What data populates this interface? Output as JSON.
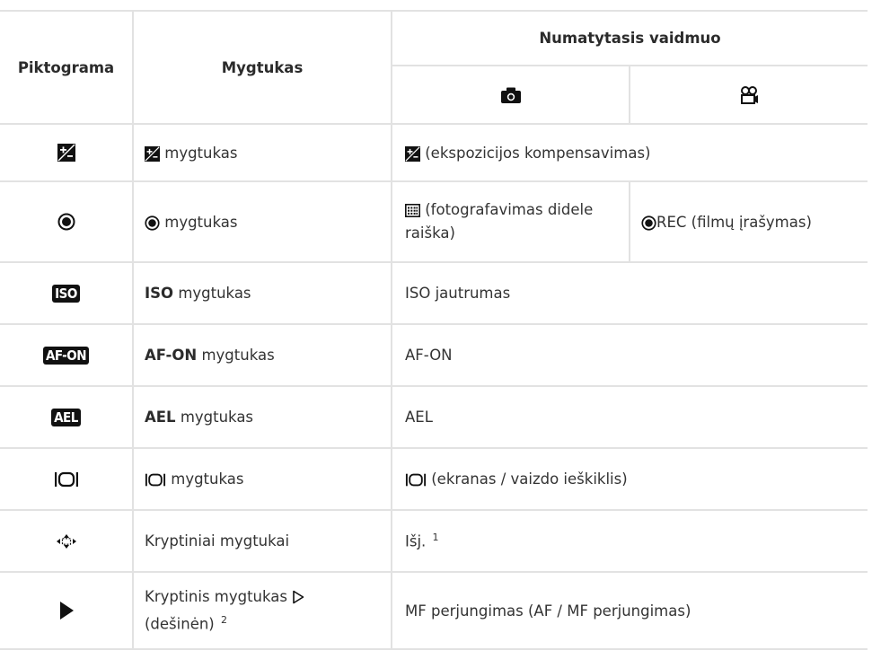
{
  "header": {
    "col_icon": "Piktograma",
    "col_button": "Mygtukas",
    "col_default": "Numatytasis vaidmuo"
  },
  "rows": [
    {
      "icon": "exposure-comp-icon",
      "button_suffix": "mygtukas",
      "function": "(ekspozicijos kompensavimas)"
    },
    {
      "icon": "record-icon",
      "button_suffix": "mygtukas",
      "photo_function": "(fotografavimas didele raiška)",
      "photo_line1": "(fotografavimas didele",
      "photo_line2": "raiška)",
      "movie_function": "REC (filmų įrašymas)"
    },
    {
      "icon": "ISO",
      "button_bold": "ISO",
      "button_suffix": "mygtukas",
      "function": "ISO jautrumas"
    },
    {
      "icon": "AF-ON",
      "button_bold": "AF-ON",
      "button_suffix": "mygtukas",
      "function": "AF-ON"
    },
    {
      "icon": "AEL",
      "button_bold": "AEL",
      "button_suffix": "mygtukas",
      "function": "AEL"
    },
    {
      "icon": "lcd-evf-icon",
      "button_suffix": "mygtukas",
      "function": "(ekranas / vaizdo ieškiklis)"
    },
    {
      "icon": "arrow-pad-icon",
      "button": "Kryptiniai mygtukai",
      "function": "Išj.",
      "function_note": "1"
    },
    {
      "icon": "play-icon",
      "button_line1": "Kryptinis mygtukas",
      "button_line2": "(dešinėn)",
      "button_note": "2",
      "function": "MF perjungimas (AF / MF perjungimas)"
    }
  ]
}
